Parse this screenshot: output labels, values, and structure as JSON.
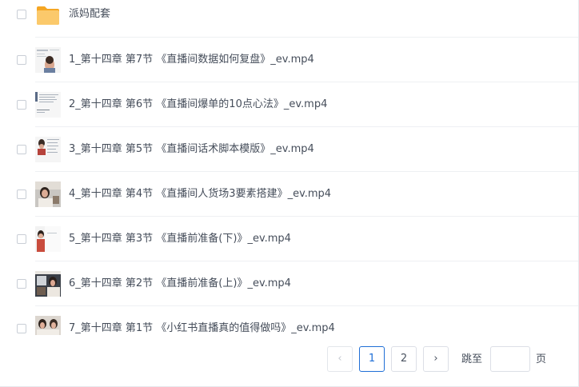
{
  "files": [
    {
      "name": "派妈配套",
      "type": "folder",
      "icon": "folder-icon"
    },
    {
      "name": "1_第十四章 第7节 《直播间数据如何复盘》_ev.mp4",
      "type": "video",
      "icon": "video-thumbnail"
    },
    {
      "name": "2_第十四章 第6节 《直播间爆单的10点心法》_ev.mp4",
      "type": "video",
      "icon": "video-thumbnail"
    },
    {
      "name": "3_第十四章 第5节 《直播间话术脚本模版》_ev.mp4",
      "type": "video",
      "icon": "video-thumbnail"
    },
    {
      "name": "4_第十四章 第4节 《直播间人货场3要素搭建》_ev.mp4",
      "type": "video",
      "icon": "video-thumbnail"
    },
    {
      "name": "5_第十四章 第3节 《直播前准备(下)》_ev.mp4",
      "type": "video",
      "icon": "video-thumbnail"
    },
    {
      "name": "6_第十四章 第2节 《直播前准备(上)》_ev.mp4",
      "type": "video",
      "icon": "video-thumbnail"
    },
    {
      "name": "7_第十四章 第1节 《小红书直播真的值得做吗》_ev.mp4",
      "type": "video",
      "icon": "video-thumbnail"
    }
  ],
  "pagination": {
    "prev_icon": "‹",
    "pages": [
      "1",
      "2"
    ],
    "current_page": "1",
    "next_icon": "›",
    "jump_label": "跳至",
    "page_unit": "页",
    "jump_value": ""
  },
  "colors": {
    "accent": "#1f6fd6",
    "folder": "#f9bd5a",
    "text": "#454d5a",
    "border": "#dcdfe6"
  }
}
